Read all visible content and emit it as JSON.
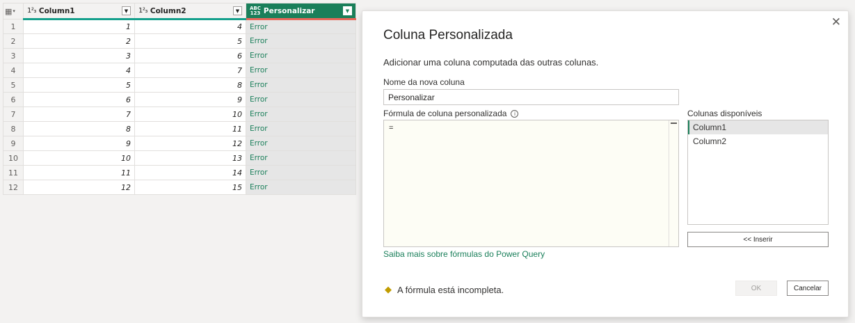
{
  "grid": {
    "columns": [
      {
        "type_icon": "1²₃",
        "name": "Column1"
      },
      {
        "type_icon": "1²₃",
        "name": "Column2"
      },
      {
        "type_icon_top": "ABC",
        "type_icon_bottom": "123",
        "name": "Personalizar"
      }
    ],
    "rows": [
      {
        "n": "1",
        "c1": "1",
        "c2": "4",
        "c3": "Error"
      },
      {
        "n": "2",
        "c1": "2",
        "c2": "5",
        "c3": "Error"
      },
      {
        "n": "3",
        "c1": "3",
        "c2": "6",
        "c3": "Error"
      },
      {
        "n": "4",
        "c1": "4",
        "c2": "7",
        "c3": "Error"
      },
      {
        "n": "5",
        "c1": "5",
        "c2": "8",
        "c3": "Error"
      },
      {
        "n": "6",
        "c1": "6",
        "c2": "9",
        "c3": "Error"
      },
      {
        "n": "7",
        "c1": "7",
        "c2": "10",
        "c3": "Error"
      },
      {
        "n": "8",
        "c1": "8",
        "c2": "11",
        "c3": "Error"
      },
      {
        "n": "9",
        "c1": "9",
        "c2": "12",
        "c3": "Error"
      },
      {
        "n": "10",
        "c1": "10",
        "c2": "13",
        "c3": "Error"
      },
      {
        "n": "11",
        "c1": "11",
        "c2": "14",
        "c3": "Error"
      },
      {
        "n": "12",
        "c1": "12",
        "c2": "15",
        "c3": "Error"
      }
    ]
  },
  "dialog": {
    "title": "Coluna Personalizada",
    "subtitle": "Adicionar uma coluna computada das outras colunas.",
    "name_label": "Nome da nova coluna",
    "name_value": "Personalizar",
    "formula_label": "Fórmula de coluna personalizada",
    "formula_value": "=",
    "available_label": "Colunas disponíveis",
    "available_columns": [
      "Column1",
      "Column2"
    ],
    "insert_label": "<< Inserir",
    "learn_link": "Saiba mais sobre fórmulas do Power Query",
    "warning": "A fórmula está incompleta.",
    "ok_label": "OK",
    "cancel_label": "Cancelar"
  },
  "colors": {
    "accent": "#1a7f5a",
    "column_quality_good": "#15a08c",
    "column_quality_error": "#e8675a"
  }
}
